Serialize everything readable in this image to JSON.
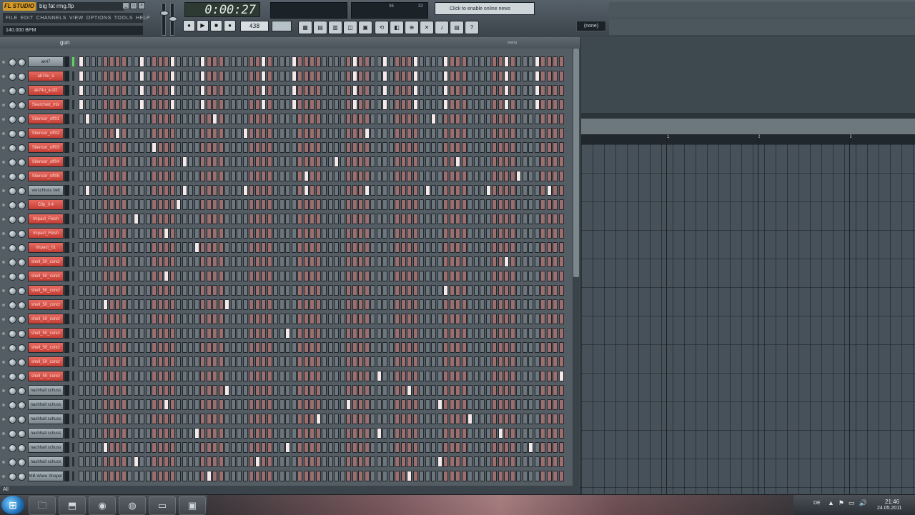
{
  "app": {
    "logo": "FL STUDIO",
    "project_name": "big fat rmg.flp",
    "tempo": "140.000 BPM",
    "time": "0:00:27",
    "hint": "Click to enable online news",
    "pattern_number": "438",
    "monitor_values": [
      "36",
      "32"
    ],
    "snap_value": "(none)",
    "window_controls": [
      "_",
      "□",
      "×"
    ]
  },
  "menu": [
    "FILE",
    "EDIT",
    "CHANNELS",
    "VIEW",
    "OPTIONS",
    "TOOLS",
    "HELP"
  ],
  "transport": [
    "●",
    "▶",
    "■",
    "●"
  ],
  "tool_icons": [
    "▦",
    "▤",
    "▥",
    "◫",
    "▣"
  ],
  "tool_icons2": [
    "⟲",
    "◧",
    "⊕",
    "✕",
    "♪",
    "▤",
    "?"
  ],
  "rack": {
    "title": "gun",
    "swing_label": "swing",
    "footer": "All",
    "channels": [
      {
        "name": "ak47",
        "color": "gray"
      },
      {
        "name": "ak74u_a",
        "color": "red"
      },
      {
        "name": "ak74u_a.sf2",
        "color": "red"
      },
      {
        "name": "Searched_mix",
        "color": "red"
      },
      {
        "name": "Silencer_off01",
        "color": "red"
      },
      {
        "name": "Silencer_off02",
        "color": "red"
      },
      {
        "name": "Silencer_off03",
        "color": "red"
      },
      {
        "name": "Silencer_off04",
        "color": "red"
      },
      {
        "name": "Silencer_off05",
        "color": "red"
      },
      {
        "name": "verschluss bell",
        "color": "gray"
      },
      {
        "name": "Clip_0.4",
        "color": "red"
      },
      {
        "name": "Impact_Flesh",
        "color": "red"
      },
      {
        "name": "Impact_Flesh",
        "color": "red"
      },
      {
        "name": "Impact_01",
        "color": "red"
      },
      {
        "name": "shell_50_concr",
        "color": "red"
      },
      {
        "name": "shell_50_concr",
        "color": "red"
      },
      {
        "name": "shell_50_concr",
        "color": "red"
      },
      {
        "name": "shell_50_concr",
        "color": "red"
      },
      {
        "name": "shell_50_concr",
        "color": "red"
      },
      {
        "name": "shell_50_concr",
        "color": "red"
      },
      {
        "name": "shell_50_concr",
        "color": "red"
      },
      {
        "name": "shell_50_concr",
        "color": "red"
      },
      {
        "name": "shell_50_concr",
        "color": "red"
      },
      {
        "name": "nachhall schuss",
        "color": "gray"
      },
      {
        "name": "nachhall schuss",
        "color": "gray"
      },
      {
        "name": "nachhall schuss",
        "color": "gray"
      },
      {
        "name": "nachhall schuss",
        "color": "gray"
      },
      {
        "name": "nachhall schuss",
        "color": "gray"
      },
      {
        "name": "nachhall schuss",
        "color": "gray"
      },
      {
        "name": "MB Wave Shaper",
        "color": "gray"
      }
    ],
    "steps_per_row": 80,
    "active_steps": [
      [
        0,
        10,
        15,
        20,
        30,
        35,
        45,
        50,
        55,
        60,
        70,
        75
      ],
      [
        0,
        10,
        15,
        20,
        30,
        35,
        45,
        50,
        55,
        60,
        70,
        75
      ],
      [
        0,
        10,
        15,
        20,
        30,
        35,
        45,
        50,
        55,
        60,
        70,
        75
      ],
      [
        0,
        10,
        15,
        20,
        30,
        35,
        45,
        50,
        55,
        60,
        70,
        75
      ],
      [
        1,
        22,
        58
      ],
      [
        6,
        27,
        47
      ],
      [
        12
      ],
      [
        17,
        42,
        62
      ],
      [
        37,
        72
      ],
      [
        1,
        17,
        27,
        37,
        47,
        57,
        67,
        77
      ],
      [
        16
      ],
      [
        9
      ],
      [
        14
      ],
      [
        19
      ],
      [
        70
      ],
      [
        14
      ],
      [
        60
      ],
      [
        4,
        24
      ],
      [],
      [
        34
      ],
      [],
      [],
      [
        49,
        79
      ],
      [
        24,
        54
      ],
      [
        14,
        44,
        59
      ],
      [
        39,
        64
      ],
      [
        19,
        49,
        69
      ],
      [
        4,
        34,
        74
      ],
      [
        9,
        29,
        59
      ],
      [
        21,
        54
      ]
    ]
  },
  "playlist": {
    "ruler": [
      "1",
      "2",
      "3"
    ]
  },
  "taskbar": {
    "start_icon": "⊞",
    "tasks": [
      "🗀",
      "⬒",
      "◉",
      "◍",
      "▭",
      "▣"
    ],
    "tray_lang": "DE",
    "tray_icons": [
      "▲",
      "⚑",
      "▭",
      "🔊"
    ],
    "time": "21:46",
    "date": "24.05.2011"
  },
  "colors": {
    "step_gray": "#6d767c",
    "step_red": "#9c6e6e",
    "step_on": "#f5e9ea",
    "channel_red": "#d4483e"
  }
}
